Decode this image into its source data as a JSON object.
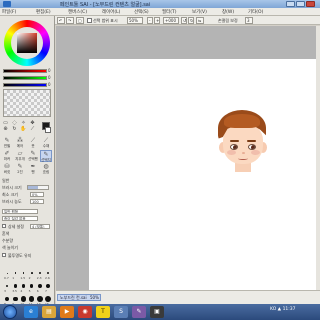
{
  "window": {
    "title": "페인트툴 SAI - [노부드린 컨텐츠 얼굴].sai",
    "logo": "SAI"
  },
  "menu": {
    "items": [
      "파일(F)",
      "편집(E)",
      "캔버스(C)",
      "레이어(L)",
      "선택(S)",
      "필터(T)",
      "보기(V)",
      "창(W)",
      "기타(O)"
    ]
  },
  "toolbar": {
    "selection_checkbox_label": "선택 범위 표시",
    "zoom": "50%",
    "rotation": "+000",
    "stabilizer_label": "손떨림 보정",
    "stabilizer_value": "3"
  },
  "color": {
    "rgb_labels": [
      "R",
      "G",
      "B"
    ],
    "rgb_values": [
      "0",
      "0",
      "0"
    ],
    "foreground": "#1a1a1a",
    "background": "#ffffff"
  },
  "tools": {
    "items": [
      "selection-tool",
      "lasso-tool",
      "magic-wand-tool",
      "move-tool",
      "zoom-tool",
      "rotate-tool",
      "hand-tool",
      "eyedropper-tool"
    ]
  },
  "brushes": {
    "items": [
      {
        "icon": "pencil-icon",
        "label": "연필"
      },
      {
        "icon": "airbrush-icon",
        "label": "에어"
      },
      {
        "icon": "brush-icon",
        "label": "붓"
      },
      {
        "icon": "watercolor-icon",
        "label": "수채"
      },
      {
        "icon": "marker-icon",
        "label": "마커"
      },
      {
        "icon": "eraser-icon",
        "label": "지우개"
      },
      {
        "icon": "select-pen-icon",
        "label": "선택펜"
      },
      {
        "icon": "deselect-pen-icon",
        "label": "선택지"
      },
      {
        "icon": "bucket-icon",
        "label": "버킷"
      },
      {
        "icon": "binary-pen-icon",
        "label": "2진"
      },
      {
        "icon": "pen-icon",
        "label": "펜"
      },
      {
        "icon": "blur-icon",
        "label": "흐림"
      }
    ],
    "selected_index": 7
  },
  "brush_props": {
    "mode": "일반",
    "size_label": "브러시 크기",
    "size_value": "3.0",
    "min_size_label": "최소 크기",
    "min_size_value": "0%",
    "density_label": "브러시 농도",
    "density_value": "100",
    "shape_label": "일반 원형",
    "texture_label": "종이 질감 없음",
    "blend_label": "혼색",
    "water_label": "수분량",
    "color_extend_label": "색 늘이기",
    "keep_opacity_label": "불투명도 유지",
    "detailed_label": "상세 설정",
    "quality_label": "4 (보통)"
  },
  "size_presets": {
    "labels": [
      "0.7",
      "1",
      "1.5",
      "2",
      "2.3",
      "2.6",
      "3",
      "3.5",
      "4",
      "5",
      "6",
      "7",
      "8",
      "9",
      "10",
      "12",
      "14",
      "16",
      "20",
      "25",
      "30",
      "35",
      "40",
      "50"
    ]
  },
  "navigator": {
    "tab_label": "노부드린 컨.sai",
    "zoom": "50%"
  },
  "taskbar": {
    "icons": [
      "ie-icon",
      "folder-icon",
      "media-icon",
      "chrome-icon",
      "kakaotalk-icon",
      "sai-icon",
      "paint-icon",
      "app-icon"
    ],
    "tray_text": "KO ▲ 11:37"
  }
}
